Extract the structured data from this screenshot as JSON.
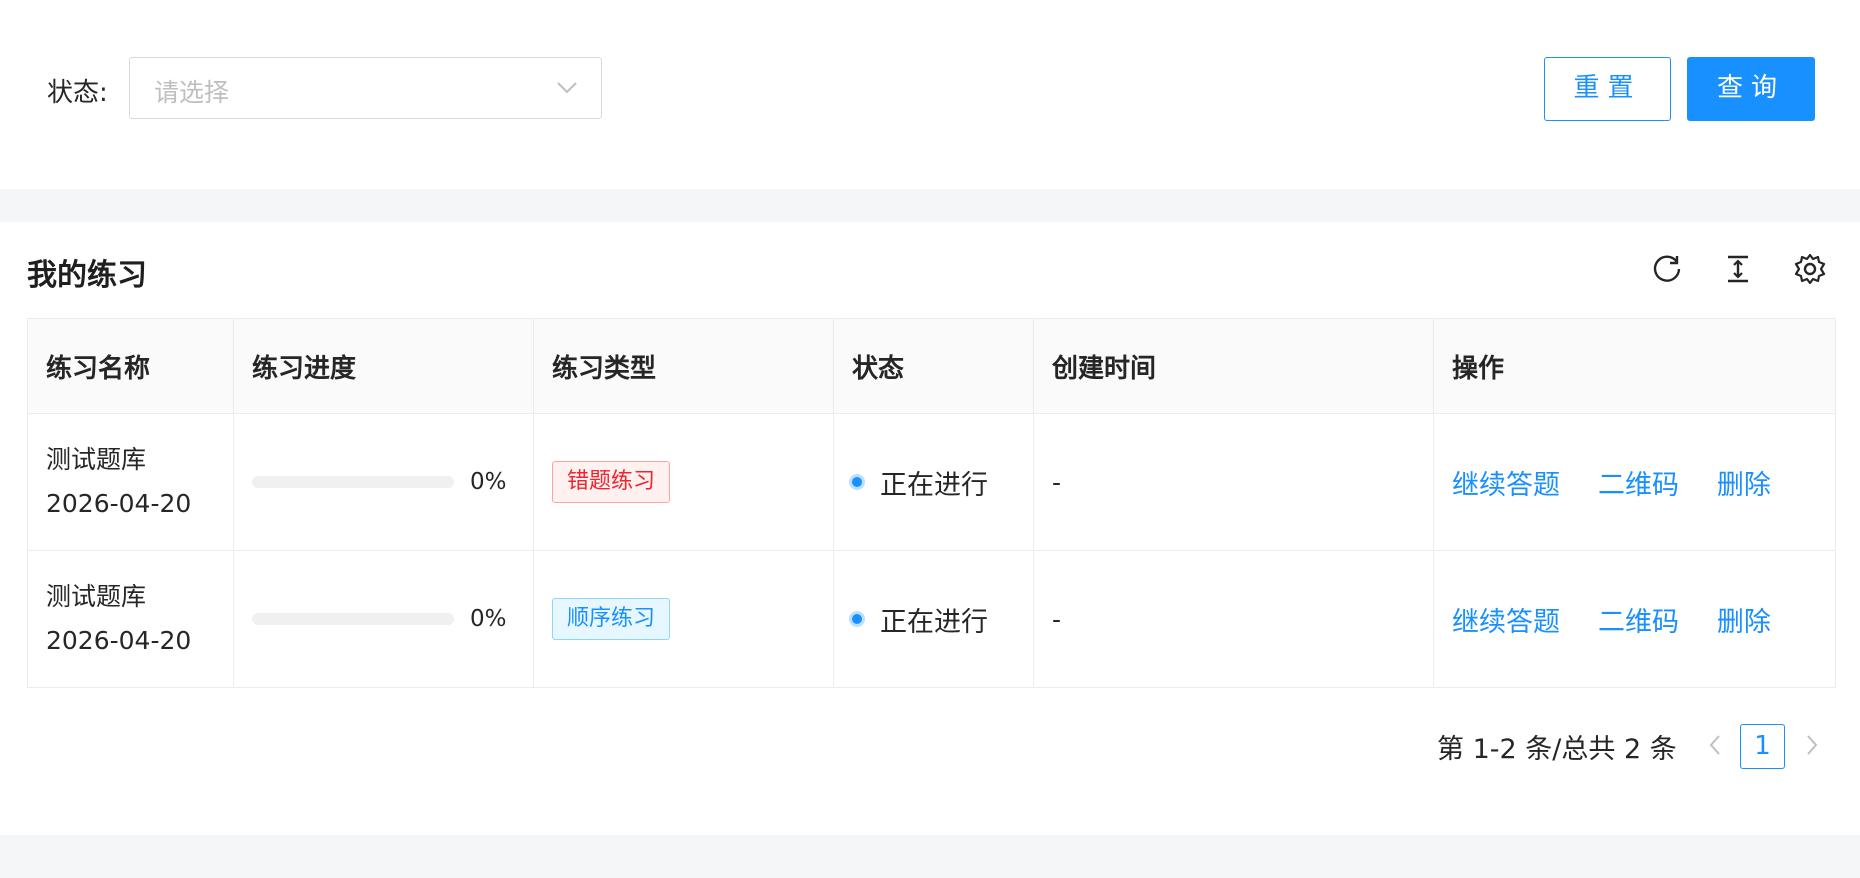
{
  "search": {
    "status_label": "状态:",
    "status_placeholder": "请选择",
    "reset_label": "重置",
    "query_label": "查询"
  },
  "panel": {
    "title": "我的练习",
    "tools": [
      "reload-icon",
      "column-height-icon",
      "settings-icon"
    ]
  },
  "table": {
    "headers": [
      "练习名称",
      "练习进度",
      "练习类型",
      "状态",
      "创建时间",
      "操作"
    ],
    "rows": [
      {
        "name": "测试题库",
        "date": "2026-04-20",
        "progress": "0%",
        "type": "错题练习",
        "status": "正在进行",
        "created": "-",
        "actions": [
          "继续答题",
          "二维码",
          "删除"
        ]
      },
      {
        "name": "测试题库",
        "date": "2026-04-20",
        "progress": "0%",
        "type": "顺序练习",
        "status": "正在进行",
        "created": "-",
        "actions": [
          "继续答题",
          "二维码",
          "删除"
        ]
      }
    ]
  },
  "pagination": {
    "total_text": "第 1-2 条/总共 2 条",
    "current_page": "1"
  },
  "colors": {
    "primary": "#1890ff",
    "tag_red": "#f5222d",
    "tag_blue": "#1890ff"
  }
}
